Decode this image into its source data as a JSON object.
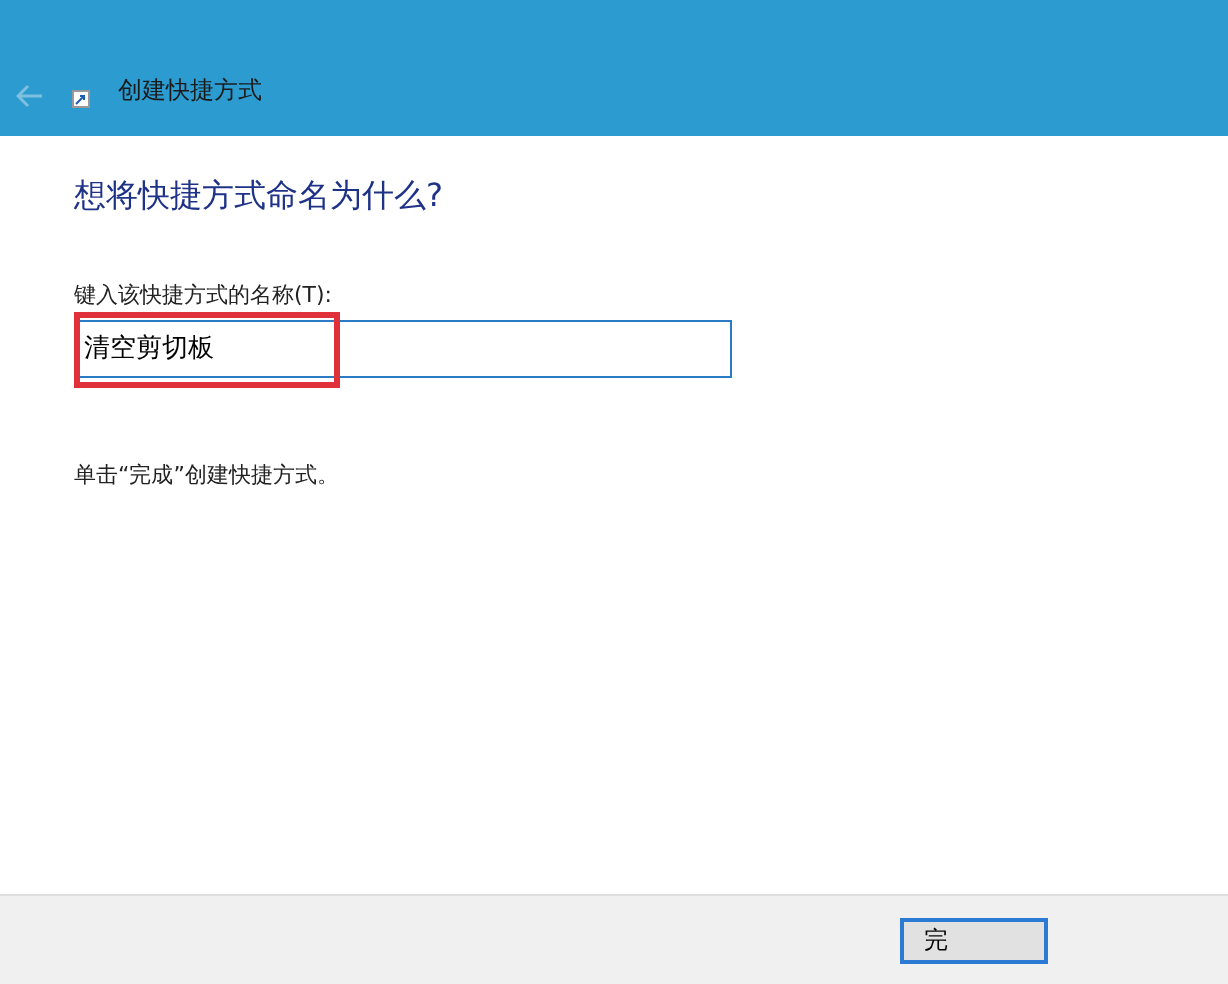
{
  "window": {
    "title": "创建快捷方式"
  },
  "heading": "想将快捷方式命名为什么?",
  "name_field": {
    "label": "键入该快捷方式的名称(T):",
    "value": "清空剪切板",
    "highlighted": true
  },
  "hint": "单击“完成”创建快捷方式。",
  "buttons": [
    {
      "label": "完",
      "default": true
    }
  ]
}
